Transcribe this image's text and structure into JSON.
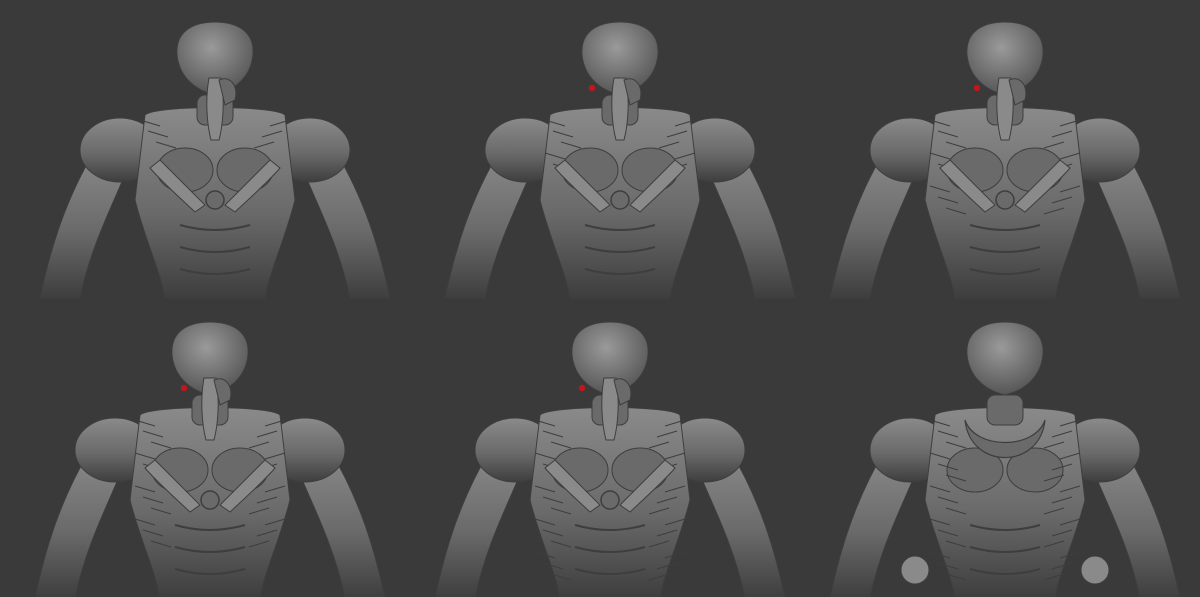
{
  "background_color": "#3a3a3a",
  "sculpt_color_light": "#8a8a8a",
  "sculpt_color_mid": "#6a6a6a",
  "sculpt_color_dark": "#3e3e3e",
  "eye_color": "#c0181a",
  "panels": [
    {
      "view": "front",
      "stage": 1,
      "eye_visible": false,
      "detail_level": 1
    },
    {
      "view": "front",
      "stage": 2,
      "eye_visible": true,
      "detail_level": 2
    },
    {
      "view": "front",
      "stage": 3,
      "eye_visible": true,
      "detail_level": 3
    },
    {
      "view": "front",
      "stage": 4,
      "eye_visible": true,
      "detail_level": 4
    },
    {
      "view": "front",
      "stage": 5,
      "eye_visible": true,
      "detail_level": 5
    },
    {
      "view": "back",
      "stage": 6,
      "eye_visible": false,
      "detail_level": 5
    }
  ]
}
